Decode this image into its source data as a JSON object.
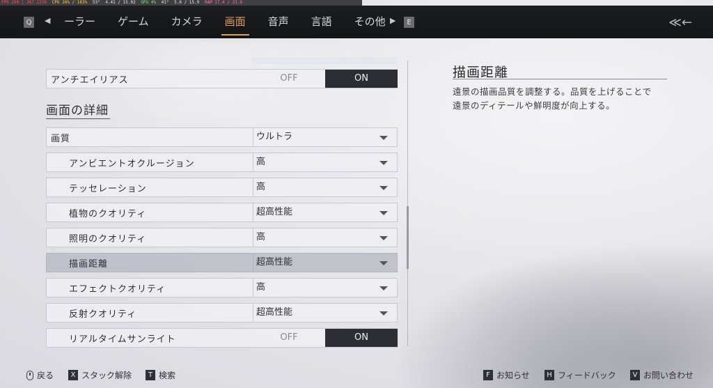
{
  "overlay": {
    "fps": "FPS 299 | 267 1326",
    "cpu": "CPU 26% / 183%",
    "temp": "53°",
    "cpu_clock": "4.41 / 15.02",
    "gpu": "GPU 4%",
    "gpu_temp": "41°",
    "vram": "5.6 / 15.9",
    "ram": "RAM 17.4 / 31.6"
  },
  "nav": {
    "key_prev": "Q",
    "key_next": "E",
    "prev_arrow": "◀",
    "next_arrow": "▶",
    "tabs": [
      {
        "label": "ーラー"
      },
      {
        "label": "ゲーム"
      },
      {
        "label": "カメラ"
      },
      {
        "label": "画面"
      },
      {
        "label": "音声"
      },
      {
        "label": "言語"
      },
      {
        "label": "その他"
      }
    ],
    "active_tab": "画面",
    "back_icon": "≪←"
  },
  "settings": {
    "antialias": {
      "label": "アンチエイリアス",
      "off": "OFF",
      "on": "ON",
      "value": "ON"
    },
    "section_title": "画面の詳細",
    "rows": [
      {
        "label": "画質",
        "value": "ウルトラ"
      },
      {
        "label": "アンビエントオクルージョン",
        "value": "高"
      },
      {
        "label": "テッセレーション",
        "value": "高"
      },
      {
        "label": "植物のクオリティ",
        "value": "超高性能"
      },
      {
        "label": "照明のクオリティ",
        "value": "高"
      },
      {
        "label": "描画距離",
        "value": "超高性能"
      },
      {
        "label": "エフェクトクオリティ",
        "value": "高"
      },
      {
        "label": "反射クオリティ",
        "value": "超高性能"
      }
    ],
    "realtime_sun": {
      "label": "リアルタイムサンライト",
      "off": "OFF",
      "on": "ON",
      "value": "ON"
    }
  },
  "description": {
    "title": "描画距離",
    "line1": "遠景の描画品質を調整する。品質を上げることで",
    "line2": "遠景のディテールや鮮明度が向上する。"
  },
  "footer": {
    "back": "戻る",
    "key_x": "X",
    "unstack": "スタック解除",
    "key_t": "T",
    "search": "検索",
    "key_f": "F",
    "news": "お知らせ",
    "key_h": "H",
    "feedback": "フィードバック",
    "key_v": "V",
    "contact": "お問い合わせ"
  },
  "colors": {
    "accent": "#e0a35c",
    "toggle_on": "#2d2e33",
    "nav_bg": "#17181a"
  }
}
